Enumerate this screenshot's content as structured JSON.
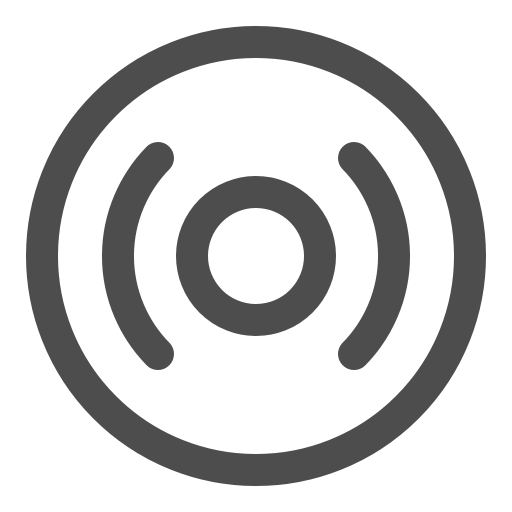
{
  "icon": {
    "name": "broadcast-disc-icon",
    "color": "#4d4d4d",
    "background": "#ffffff"
  }
}
